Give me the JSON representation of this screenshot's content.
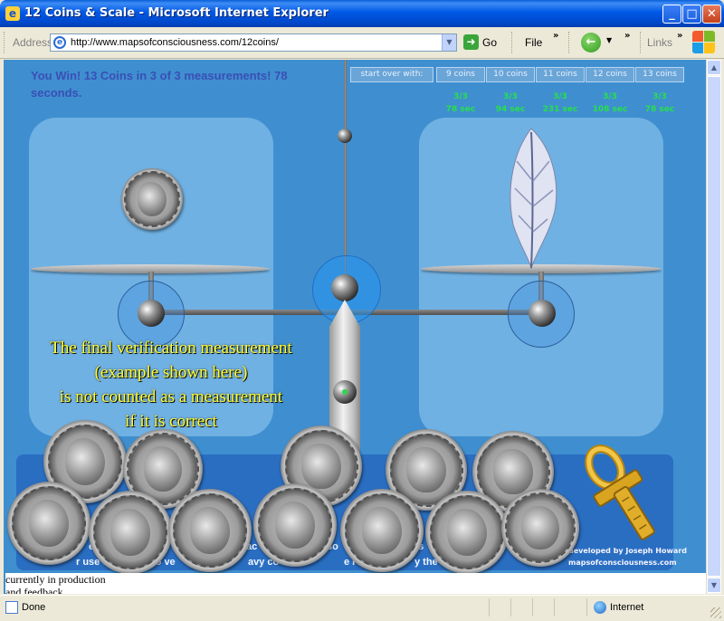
{
  "window": {
    "title": "12 Coins & Scale - Microsoft Internet Explorer",
    "controls": {
      "minimize": "_",
      "maximize": "□",
      "close": "✕"
    }
  },
  "toolbar": {
    "address_label": "Address",
    "url": "http://www.mapsofconsciousness.com/12coins/",
    "go_label": "Go",
    "file_label": "File",
    "links_label": "Links",
    "chevron": "»"
  },
  "game": {
    "win_message": "You Win! 13 Coins in 3 of 3 measurements! 78 seconds.",
    "start_over_label": "start over with:",
    "start_options": [
      "9 coins",
      "10 coins",
      "11 coins",
      "12 coins",
      "13 coins"
    ],
    "scores": [
      {
        "result": "3/3",
        "time": "78 sec"
      },
      {
        "result": "3/3",
        "time": "94 sec"
      },
      {
        "result": "3/3",
        "time": "231 sec"
      },
      {
        "result": "3/3",
        "time": "108 sec"
      },
      {
        "result": "3/3",
        "time": "78 sec"
      }
    ],
    "overlay_lines": [
      "The final verification measurement",
      "(example shown here)",
      "is not counted as a measurement",
      "if it is correct"
    ],
    "panel_line1_parts": [
      "e",
      "ac",
      "so",
      "es"
    ],
    "panel_line2_parts": [
      "r use th",
      "to ve",
      "avy co",
      "e Feath",
      "y the ig"
    ],
    "credit_line1": "developed by Joseph Howard",
    "credit_line2": "mapsofconsciousness.com",
    "footer_line1": "currently in production",
    "footer_line2": "and feedback"
  },
  "statusbar": {
    "status": "Done",
    "zone": "Internet"
  },
  "colors": {
    "page_background": "#3f8fd0",
    "pan_background": "#70b1e3",
    "win_text": "#3a4fb5",
    "score_text": "#27e04a",
    "overlay_text": "#ffff33"
  }
}
